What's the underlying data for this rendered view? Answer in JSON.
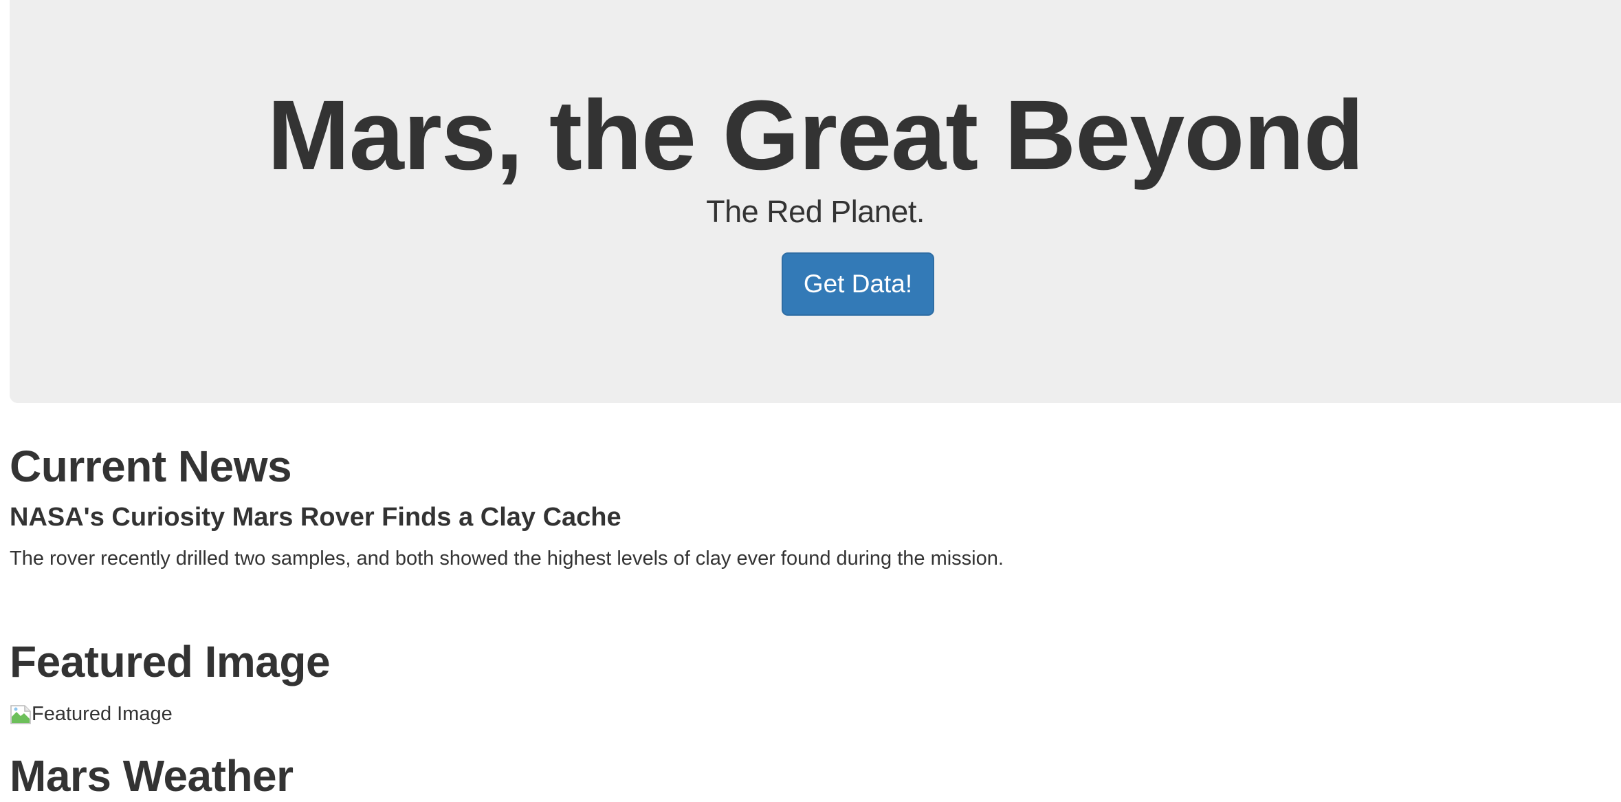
{
  "hero": {
    "title": "Mars, the Great Beyond",
    "subtitle": "The Red Planet.",
    "button_label": "Get Data!"
  },
  "news": {
    "heading": "Current News",
    "title": "NASA's Curiosity Mars Rover Finds a Clay Cache",
    "body": "The rover recently drilled two samples, and both showed the highest levels of clay ever found during the mission."
  },
  "featured": {
    "heading": "Featured Image",
    "image_alt": "Featured Image",
    "icon": "broken-image-icon"
  },
  "weather": {
    "heading": "Mars Weather"
  },
  "colors": {
    "jumbotron_bg": "#eeeeee",
    "primary_button": "#337ab7",
    "text": "#333333"
  }
}
